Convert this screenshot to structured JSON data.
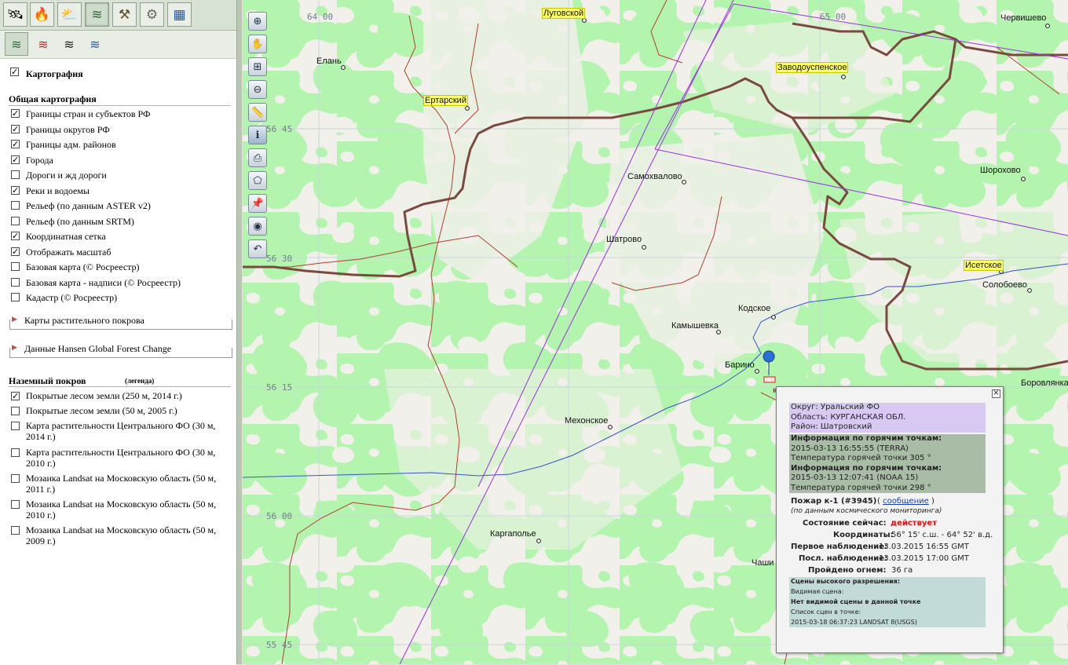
{
  "toolbar_tabs": [
    {
      "name": "layers-tab",
      "icon": "satellite-icon",
      "glyph": "🛰"
    },
    {
      "name": "fires-tab",
      "icon": "fire-icon",
      "glyph": "🔥"
    },
    {
      "name": "weather-tab",
      "icon": "weather-icon",
      "glyph": "⛅"
    },
    {
      "name": "maps-tab",
      "icon": "layers-icon",
      "glyph": "≋"
    },
    {
      "name": "tools-tab",
      "icon": "tools-icon",
      "glyph": "⚒"
    },
    {
      "name": "settings-tab",
      "icon": "gear-icon",
      "glyph": "⚙"
    },
    {
      "name": "table-tab",
      "icon": "table-icon",
      "glyph": "▦"
    }
  ],
  "sub_tabs": [
    {
      "icon": "layers-icon",
      "glyph": "≋"
    },
    {
      "icon": "layers-red-icon",
      "glyph": "≋"
    },
    {
      "icon": "layers-dark-icon",
      "glyph": "≋"
    },
    {
      "icon": "layers-globe-icon",
      "glyph": "≋"
    }
  ],
  "panel": {
    "section_title": "Картография",
    "section_checked": true,
    "general_heading": "Общая картография",
    "general_items": [
      {
        "label": "Границы стран и субъектов РФ",
        "checked": true
      },
      {
        "label": "Границы округов РФ",
        "checked": true
      },
      {
        "label": "Границы адм. районов",
        "checked": true
      },
      {
        "label": "Города",
        "checked": true
      },
      {
        "label": "Дороги и жд дороги",
        "checked": false
      },
      {
        "label": "Реки и водоемы",
        "checked": true
      },
      {
        "label": "Рельеф (по данным ASTER v2)",
        "checked": false
      },
      {
        "label": "Рельеф (по данным SRTM)",
        "checked": false
      },
      {
        "label": "Координатная сетка",
        "checked": true
      },
      {
        "label": "Отображать масштаб",
        "checked": true
      },
      {
        "label": "Базовая карта (© Росреестр)",
        "checked": false
      },
      {
        "label": "Базовая карта - надписи (© Росреестр)",
        "checked": false
      },
      {
        "label": "Кадастр (© Росреестр)",
        "checked": false
      }
    ],
    "group_vegetation": "Карты растительного покрова",
    "group_hansen": "Данные Hansen Global Forest Change",
    "land_heading": "Наземный покров",
    "land_legend": "(легенда)",
    "land_items": [
      {
        "label": "Покрытые лесом земли (250 м, 2014 г.)",
        "checked": true
      },
      {
        "label": "Покрытые лесом земли (50 м, 2005 г.)",
        "checked": false
      },
      {
        "label": "Карта растительности Центрального ФО (30 м, 2014 г.)",
        "checked": false
      },
      {
        "label": "Карта растительности Центрального ФО (30 м, 2010 г.)",
        "checked": false
      },
      {
        "label": "Мозаика Landsat на Московскую область (50 м, 2011 г.)",
        "checked": false
      },
      {
        "label": "Мозаика Landsat на Московскую область (50 м, 2010 г.)",
        "checked": false
      },
      {
        "label": "Мозаика Landsat на Московскую область (50 м, 2009 г.)",
        "checked": false
      }
    ]
  },
  "map_tools": [
    {
      "name": "zoom-extent-button",
      "icon": "globe-zoom-icon",
      "glyph": "⊕"
    },
    {
      "name": "pan-button",
      "icon": "hand-icon",
      "glyph": "✋"
    },
    {
      "name": "zoom-box-button",
      "icon": "zoom-box-icon",
      "glyph": "⊞"
    },
    {
      "name": "zoom-out-button",
      "icon": "zoom-out-icon",
      "glyph": "⊖"
    },
    {
      "name": "ruler-button",
      "icon": "ruler-icon",
      "glyph": "📏"
    },
    {
      "name": "info-button",
      "icon": "info-icon",
      "glyph": "ℹ"
    },
    {
      "name": "print-button",
      "icon": "printer-icon",
      "glyph": "⎙"
    },
    {
      "name": "polygon-button",
      "icon": "polygon-icon",
      "glyph": "⬠"
    },
    {
      "name": "pin-button",
      "icon": "pin-icon",
      "glyph": "📌"
    },
    {
      "name": "globe-button",
      "icon": "globe-icon",
      "glyph": "◉"
    },
    {
      "name": "undo-button",
      "icon": "undo-icon",
      "glyph": "↶"
    }
  ],
  "grid_labels": {
    "lon_64_00": "64 00",
    "lon_65": "65 00",
    "lat_56_45": "56 45",
    "lat_56_30": "56 30",
    "lat_56_15": "56 15",
    "lat_56_00": "56 00",
    "lat_55_45": "55 45"
  },
  "cities": {
    "lugovskoy": "Луговской",
    "chervishevo": "Червишево",
    "elan": "Елань",
    "zavodoukovskoe": "Заводоуспенское",
    "ertarsky": "Ертарский",
    "samohvalovo": "Самохвалово",
    "shorohovo": "Шорохово",
    "shatrovo": "Шатрово",
    "isetskoe": "Исетское",
    "solobоevo": "Солобоево",
    "kodskoe": "Кодское",
    "kamyshevka": "Камышевка",
    "barino": "Барино",
    "borovlyanka": "Боровлянка",
    "mehonskoe": "Мехонское",
    "kargapolye": "Каргаполье",
    "chashi": "Чаши"
  },
  "colors": {
    "forest": "#b3f5ae",
    "border": "#7a4a3f",
    "district": "#b04030",
    "river": "#3a55c8",
    "track": "#9b30e0"
  },
  "popup": {
    "okrug": "Округ: Уральский ФО",
    "oblast": "Область: КУРГАНСКАЯ ОБЛ.",
    "rayon": "Район: Шатровский",
    "info1_title": "Информация по горячим точкам:",
    "info1_time": "2015-03-13 16:55:55 (TERRA)",
    "info1_temp": "Температура горячей точки 305 °",
    "info2_title": "Информация по горячим точкам:",
    "info2_time": "2015-03-13 12:07:41 (NOAA 15)",
    "info2_temp": "Температура горячей точки 298 °",
    "fire_title": "Пожар к-1 (#3945)",
    "message_link": "сообщение",
    "monitoring_note": "(по данным космического мониторинга)",
    "state_label": "Состояние сейчас:",
    "state_value": "действует",
    "coords_label": "Координаты:",
    "coords_value": "56° 15' с.ш. - 64° 52' в.д.",
    "first_label": "Первое наблюдение:",
    "first_value": "13.03.2015 16:55 GMT",
    "last_label": "Посл. наблюдение:",
    "last_value": "13.03.2015 17:00 GMT",
    "area_label": "Пройдено огнем:",
    "area_value": "36 га",
    "hr_title": "Сцены высокого разрешения:",
    "hr_visible": "Видимая сцена:",
    "hr_none": "Нет видимой сцены в данной точке",
    "hr_list": "Список сцен в точке:",
    "hr_scene": "2015-03-18 06:37:23 LANDSAT 8(USGS)"
  }
}
